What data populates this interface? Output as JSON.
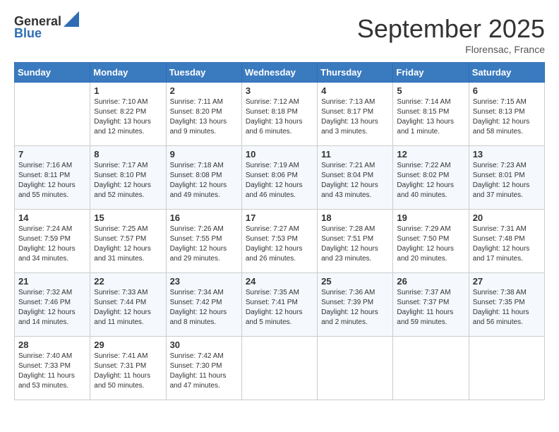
{
  "header": {
    "logo_line1": "General",
    "logo_line2": "Blue",
    "month_title": "September 2025",
    "subtitle": "Florensac, France"
  },
  "days_of_week": [
    "Sunday",
    "Monday",
    "Tuesday",
    "Wednesday",
    "Thursday",
    "Friday",
    "Saturday"
  ],
  "weeks": [
    [
      {
        "num": "",
        "sunrise": "",
        "sunset": "",
        "daylight": ""
      },
      {
        "num": "1",
        "sunrise": "Sunrise: 7:10 AM",
        "sunset": "Sunset: 8:22 PM",
        "daylight": "Daylight: 13 hours and 12 minutes."
      },
      {
        "num": "2",
        "sunrise": "Sunrise: 7:11 AM",
        "sunset": "Sunset: 8:20 PM",
        "daylight": "Daylight: 13 hours and 9 minutes."
      },
      {
        "num": "3",
        "sunrise": "Sunrise: 7:12 AM",
        "sunset": "Sunset: 8:18 PM",
        "daylight": "Daylight: 13 hours and 6 minutes."
      },
      {
        "num": "4",
        "sunrise": "Sunrise: 7:13 AM",
        "sunset": "Sunset: 8:17 PM",
        "daylight": "Daylight: 13 hours and 3 minutes."
      },
      {
        "num": "5",
        "sunrise": "Sunrise: 7:14 AM",
        "sunset": "Sunset: 8:15 PM",
        "daylight": "Daylight: 13 hours and 1 minute."
      },
      {
        "num": "6",
        "sunrise": "Sunrise: 7:15 AM",
        "sunset": "Sunset: 8:13 PM",
        "daylight": "Daylight: 12 hours and 58 minutes."
      }
    ],
    [
      {
        "num": "7",
        "sunrise": "Sunrise: 7:16 AM",
        "sunset": "Sunset: 8:11 PM",
        "daylight": "Daylight: 12 hours and 55 minutes."
      },
      {
        "num": "8",
        "sunrise": "Sunrise: 7:17 AM",
        "sunset": "Sunset: 8:10 PM",
        "daylight": "Daylight: 12 hours and 52 minutes."
      },
      {
        "num": "9",
        "sunrise": "Sunrise: 7:18 AM",
        "sunset": "Sunset: 8:08 PM",
        "daylight": "Daylight: 12 hours and 49 minutes."
      },
      {
        "num": "10",
        "sunrise": "Sunrise: 7:19 AM",
        "sunset": "Sunset: 8:06 PM",
        "daylight": "Daylight: 12 hours and 46 minutes."
      },
      {
        "num": "11",
        "sunrise": "Sunrise: 7:21 AM",
        "sunset": "Sunset: 8:04 PM",
        "daylight": "Daylight: 12 hours and 43 minutes."
      },
      {
        "num": "12",
        "sunrise": "Sunrise: 7:22 AM",
        "sunset": "Sunset: 8:02 PM",
        "daylight": "Daylight: 12 hours and 40 minutes."
      },
      {
        "num": "13",
        "sunrise": "Sunrise: 7:23 AM",
        "sunset": "Sunset: 8:01 PM",
        "daylight": "Daylight: 12 hours and 37 minutes."
      }
    ],
    [
      {
        "num": "14",
        "sunrise": "Sunrise: 7:24 AM",
        "sunset": "Sunset: 7:59 PM",
        "daylight": "Daylight: 12 hours and 34 minutes."
      },
      {
        "num": "15",
        "sunrise": "Sunrise: 7:25 AM",
        "sunset": "Sunset: 7:57 PM",
        "daylight": "Daylight: 12 hours and 31 minutes."
      },
      {
        "num": "16",
        "sunrise": "Sunrise: 7:26 AM",
        "sunset": "Sunset: 7:55 PM",
        "daylight": "Daylight: 12 hours and 29 minutes."
      },
      {
        "num": "17",
        "sunrise": "Sunrise: 7:27 AM",
        "sunset": "Sunset: 7:53 PM",
        "daylight": "Daylight: 12 hours and 26 minutes."
      },
      {
        "num": "18",
        "sunrise": "Sunrise: 7:28 AM",
        "sunset": "Sunset: 7:51 PM",
        "daylight": "Daylight: 12 hours and 23 minutes."
      },
      {
        "num": "19",
        "sunrise": "Sunrise: 7:29 AM",
        "sunset": "Sunset: 7:50 PM",
        "daylight": "Daylight: 12 hours and 20 minutes."
      },
      {
        "num": "20",
        "sunrise": "Sunrise: 7:31 AM",
        "sunset": "Sunset: 7:48 PM",
        "daylight": "Daylight: 12 hours and 17 minutes."
      }
    ],
    [
      {
        "num": "21",
        "sunrise": "Sunrise: 7:32 AM",
        "sunset": "Sunset: 7:46 PM",
        "daylight": "Daylight: 12 hours and 14 minutes."
      },
      {
        "num": "22",
        "sunrise": "Sunrise: 7:33 AM",
        "sunset": "Sunset: 7:44 PM",
        "daylight": "Daylight: 12 hours and 11 minutes."
      },
      {
        "num": "23",
        "sunrise": "Sunrise: 7:34 AM",
        "sunset": "Sunset: 7:42 PM",
        "daylight": "Daylight: 12 hours and 8 minutes."
      },
      {
        "num": "24",
        "sunrise": "Sunrise: 7:35 AM",
        "sunset": "Sunset: 7:41 PM",
        "daylight": "Daylight: 12 hours and 5 minutes."
      },
      {
        "num": "25",
        "sunrise": "Sunrise: 7:36 AM",
        "sunset": "Sunset: 7:39 PM",
        "daylight": "Daylight: 12 hours and 2 minutes."
      },
      {
        "num": "26",
        "sunrise": "Sunrise: 7:37 AM",
        "sunset": "Sunset: 7:37 PM",
        "daylight": "Daylight: 11 hours and 59 minutes."
      },
      {
        "num": "27",
        "sunrise": "Sunrise: 7:38 AM",
        "sunset": "Sunset: 7:35 PM",
        "daylight": "Daylight: 11 hours and 56 minutes."
      }
    ],
    [
      {
        "num": "28",
        "sunrise": "Sunrise: 7:40 AM",
        "sunset": "Sunset: 7:33 PM",
        "daylight": "Daylight: 11 hours and 53 minutes."
      },
      {
        "num": "29",
        "sunrise": "Sunrise: 7:41 AM",
        "sunset": "Sunset: 7:31 PM",
        "daylight": "Daylight: 11 hours and 50 minutes."
      },
      {
        "num": "30",
        "sunrise": "Sunrise: 7:42 AM",
        "sunset": "Sunset: 7:30 PM",
        "daylight": "Daylight: 11 hours and 47 minutes."
      },
      {
        "num": "",
        "sunrise": "",
        "sunset": "",
        "daylight": ""
      },
      {
        "num": "",
        "sunrise": "",
        "sunset": "",
        "daylight": ""
      },
      {
        "num": "",
        "sunrise": "",
        "sunset": "",
        "daylight": ""
      },
      {
        "num": "",
        "sunrise": "",
        "sunset": "",
        "daylight": ""
      }
    ]
  ]
}
